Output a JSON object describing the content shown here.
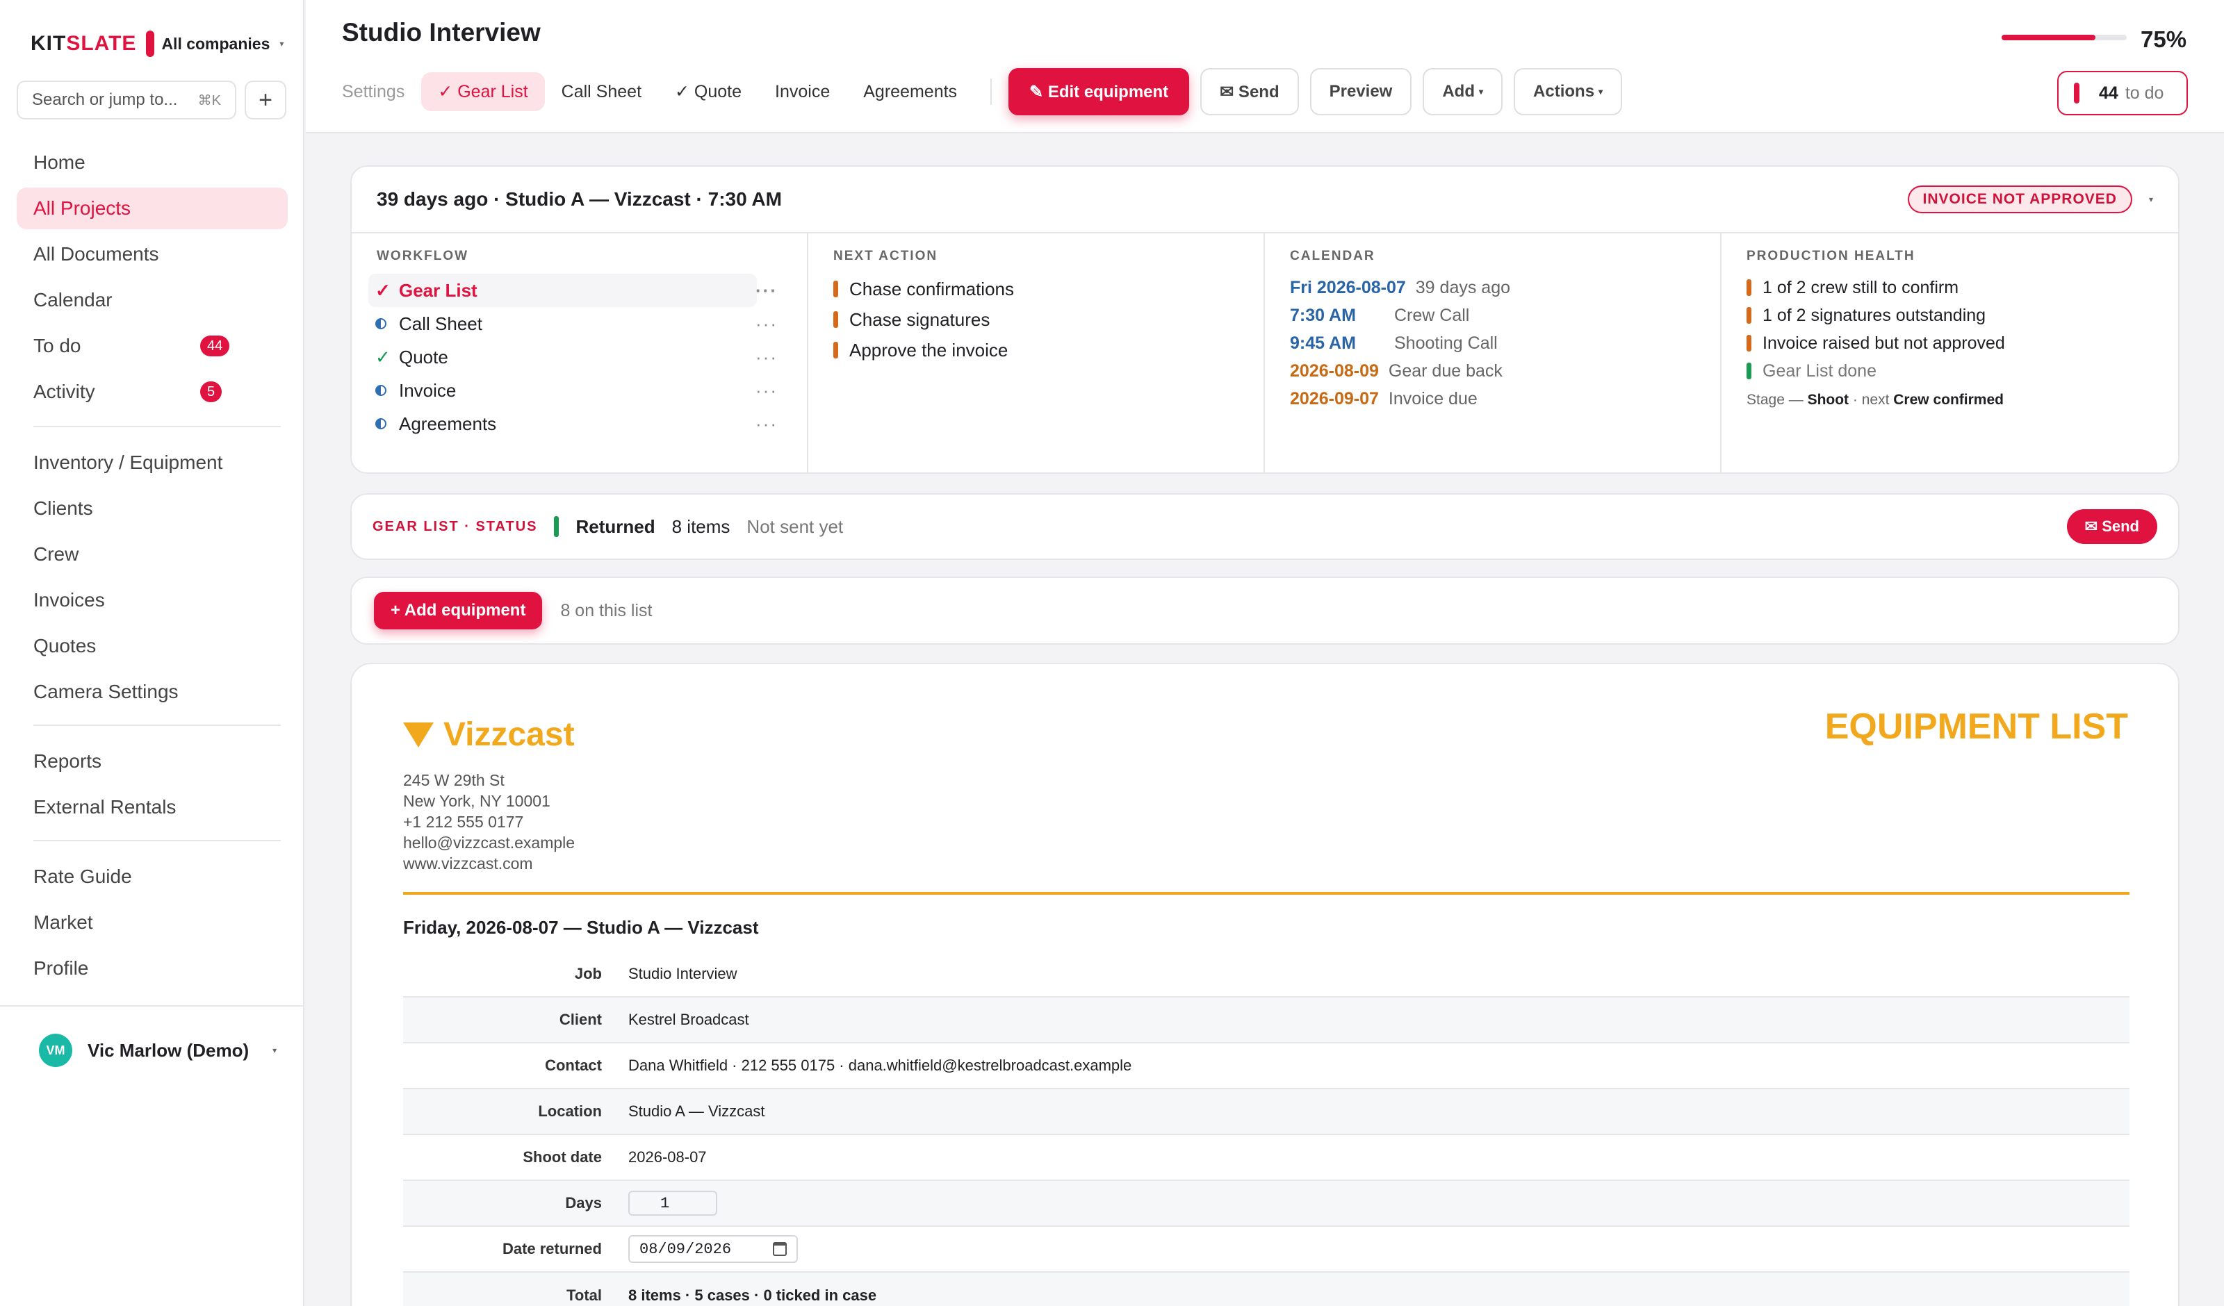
{
  "brand": {
    "part1": "KIT",
    "part2": "SLATE",
    "company": "All companies"
  },
  "search": {
    "placeholder": "Search or jump to...",
    "shortcut": "⌘K"
  },
  "sidebar": {
    "items": [
      {
        "label": "Home"
      },
      {
        "label": "All Projects"
      },
      {
        "label": "All Documents"
      },
      {
        "label": "Calendar"
      },
      {
        "label": "To do",
        "badge": "44"
      },
      {
        "label": "Activity",
        "badge": "5"
      },
      {
        "label": "Inventory / Equipment"
      },
      {
        "label": "Clients"
      },
      {
        "label": "Crew"
      },
      {
        "label": "Invoices"
      },
      {
        "label": "Quotes"
      },
      {
        "label": "Camera Settings"
      },
      {
        "label": "Reports"
      },
      {
        "label": "External Rentals"
      },
      {
        "label": "Rate Guide"
      },
      {
        "label": "Market"
      },
      {
        "label": "Profile"
      }
    ],
    "user": {
      "initials": "VM",
      "name": "Vic Marlow (Demo)"
    }
  },
  "header": {
    "title": "Studio Interview",
    "progress_pct": "75%",
    "progress_value": 0.75,
    "tabs": [
      {
        "label": "Settings"
      },
      {
        "label": "✓ Gear List"
      },
      {
        "label": "Call Sheet"
      },
      {
        "label": "✓ Quote"
      },
      {
        "label": "Invoice"
      },
      {
        "label": "Agreements"
      }
    ],
    "buttons": {
      "edit": "✎ Edit equipment",
      "send": "✉ Send",
      "preview": "Preview",
      "add": "Add",
      "actions": "Actions"
    },
    "todo": {
      "count": "44",
      "label": "to do"
    }
  },
  "project": {
    "summary": "39 days ago · Studio A — Vizzcast · 7:30 AM",
    "badge": "INVOICE NOT APPROVED",
    "workflow": {
      "heading": "WORKFLOW",
      "items": [
        {
          "label": "Gear List"
        },
        {
          "label": "Call Sheet"
        },
        {
          "label": "Quote"
        },
        {
          "label": "Invoice"
        },
        {
          "label": "Agreements"
        }
      ]
    },
    "next_action": {
      "heading": "NEXT ACTION",
      "items": [
        "Chase confirmations",
        "Chase signatures",
        "Approve the invoice"
      ]
    },
    "calendar": {
      "heading": "CALENDAR",
      "items": [
        {
          "date": "Fri 2026-08-07",
          "what": "39 days ago"
        },
        {
          "date": "7:30 AM",
          "what": "Crew Call"
        },
        {
          "date": "9:45 AM",
          "what": "Shooting Call"
        },
        {
          "date": "2026-08-09",
          "what": "Gear due back"
        },
        {
          "date": "2026-09-07",
          "what": "Invoice due"
        }
      ]
    },
    "health": {
      "heading": "PRODUCTION HEALTH",
      "items": [
        "1 of 2 crew still to confirm",
        "1 of 2 signatures outstanding",
        "Invoice raised but not approved",
        "Gear List done"
      ],
      "stage_prefix": "Stage —",
      "stage": "Shoot",
      "next_prefix": "· next",
      "next": "Crew confirmed"
    }
  },
  "gear_status": {
    "label": "GEAR LIST · STATUS",
    "value": "Returned",
    "items": "8 items",
    "note": "Not sent yet",
    "send": "✉ Send"
  },
  "add_bar": {
    "button": "+ Add equipment",
    "note": "8 on this list"
  },
  "document": {
    "company": "Vizzcast",
    "title": "EQUIPMENT LIST",
    "address": [
      "245 W 29th St",
      "New York, NY 10001",
      "+1 212 555 0177",
      "hello@vizzcast.example",
      "www.vizzcast.com"
    ],
    "subtitle": "Friday, 2026-08-07 — Studio A — Vizzcast",
    "details": [
      {
        "label": "Job",
        "value": "Studio Interview"
      },
      {
        "label": "Client",
        "value": "Kestrel Broadcast"
      },
      {
        "label": "Contact",
        "value": "Dana Whitfield · 212 555 0175 · dana.whitfield@kestrelbroadcast.example"
      },
      {
        "label": "Location",
        "value": "Studio A — Vizzcast"
      },
      {
        "label": "Shoot date",
        "value": "2026-08-07"
      },
      {
        "label": "Days",
        "value": "1"
      },
      {
        "label": "Date returned",
        "value": "08/09/2026"
      },
      {
        "label": "Total",
        "value": "8 items · 5 cases · 0 ticked in case"
      }
    ]
  },
  "colors": {
    "accent": "#e0123f",
    "brand_doc": "#f2a81c",
    "ok": "#1a9a52",
    "warn": "#d46a1a",
    "cal_blue": "#2864a6"
  }
}
